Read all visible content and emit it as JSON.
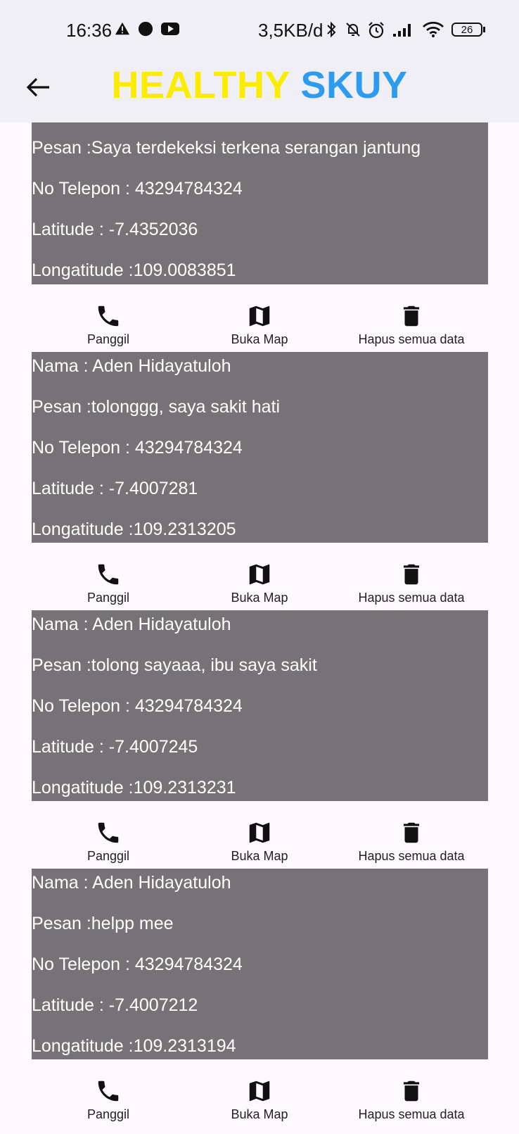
{
  "status_bar": {
    "time": "16:36",
    "network_speed": "3,5KB/d",
    "battery": "26"
  },
  "app": {
    "title_part1": "HEALTHY",
    "title_part2": "SKUY",
    "colors": {
      "title_part1": "#fcec00",
      "title_part2": "#2d9cf0",
      "card_bg": "#767276"
    }
  },
  "reports": [
    {
      "pesan": "Pesan :Saya terdekeksi terkena serangan jantung",
      "telepon": "No Telepon : 43294784324",
      "latitude": "Latitude : -7.4352036",
      "longitude": "Longatitude :109.0083851"
    },
    {
      "nama": "Nama : Aden Hidayatuloh",
      "pesan": "Pesan :tolonggg, saya sakit hati",
      "telepon": "No Telepon : 43294784324",
      "latitude": "Latitude : -7.4007281",
      "longitude": "Longatitude :109.2313205"
    },
    {
      "nama": "Nama : Aden Hidayatuloh",
      "pesan": "Pesan :tolong sayaaa, ibu saya sakit",
      "telepon": "No Telepon : 43294784324",
      "latitude": "Latitude : -7.4007245",
      "longitude": "Longatitude :109.2313231"
    },
    {
      "nama": "Nama : Aden Hidayatuloh",
      "pesan": "Pesan :helpp mee",
      "telepon": "No Telepon : 43294784324",
      "latitude": "Latitude : -7.4007212",
      "longitude": "Longatitude :109.2313194"
    }
  ],
  "actions": {
    "call_label": "Panggil",
    "map_label": "Buka Map",
    "delete_label": "Hapus semua data",
    "icons": [
      "phone-icon",
      "map-icon",
      "trash-icon"
    ]
  }
}
